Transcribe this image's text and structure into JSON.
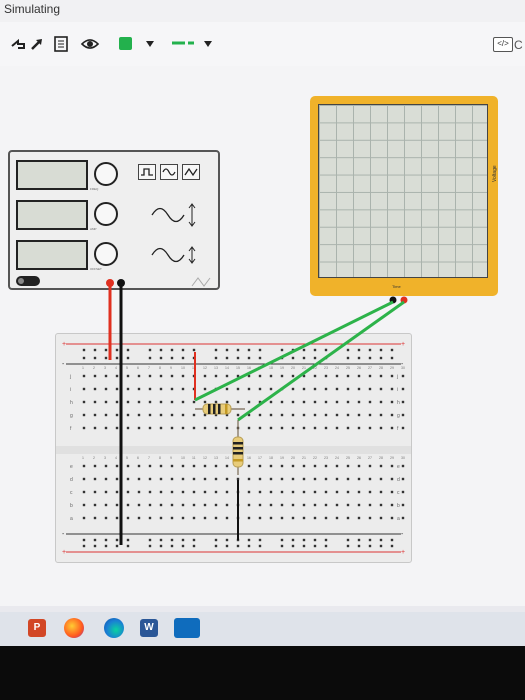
{
  "status": {
    "text": "Simulating"
  },
  "toolbar": {
    "code_label": "</>",
    "code_suffix": "C"
  },
  "function_generator": {
    "knob_labels": [
      "FREQ",
      "AMP",
      "OFFSET"
    ]
  },
  "oscilloscope": {
    "x_label": "Time",
    "y_label": "Voltage"
  },
  "breadboard": {
    "row_letters_top": [
      "j",
      "i",
      "h",
      "g",
      "f"
    ],
    "row_letters_bottom": [
      "e",
      "d",
      "c",
      "b",
      "a"
    ],
    "column_count": 30
  },
  "taskbar": {
    "word_label": "W"
  },
  "colors": {
    "oscilloscope": "#f0b22a",
    "wire_red": "#e03020",
    "wire_green": "#2db34a",
    "wire_black": "#111111",
    "toolbar_green": "#23b14d"
  },
  "icons": [
    "undo-icon",
    "redo-icon",
    "notes-icon",
    "eye-icon",
    "color-swatch-icon",
    "dropdown-icon",
    "wire-style-icon",
    "code-icon"
  ]
}
